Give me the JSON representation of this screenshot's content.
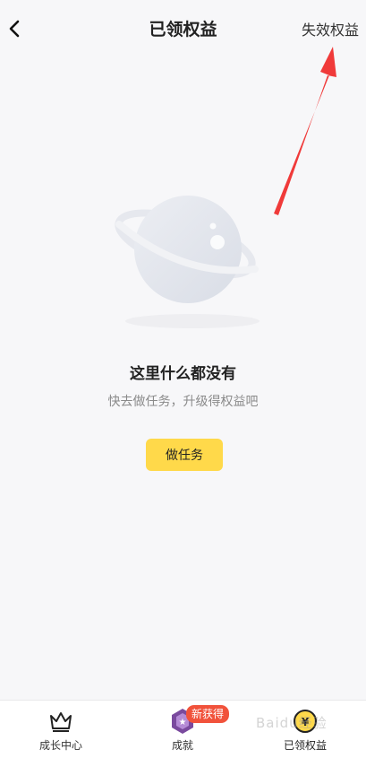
{
  "header": {
    "title": "已领权益",
    "back_icon": "chevron-left-icon",
    "right_link": "失效权益"
  },
  "annotation": {
    "color": "#f03a3a"
  },
  "empty_state": {
    "illustration": "planet-icon",
    "title": "这里什么都没有",
    "subtitle": "快去做任务，升级得权益吧",
    "button_label": "做任务",
    "button_color": "#ffd94a"
  },
  "tabbar": {
    "items": [
      {
        "label": "成长中心",
        "icon": "crown-icon"
      },
      {
        "label": "成就",
        "icon": "achievement-badge-icon",
        "badge": "新获得"
      },
      {
        "label": "已领权益",
        "icon": "coin-icon"
      }
    ],
    "badge_color": "#f1523b"
  },
  "watermark": "Baidu经验"
}
